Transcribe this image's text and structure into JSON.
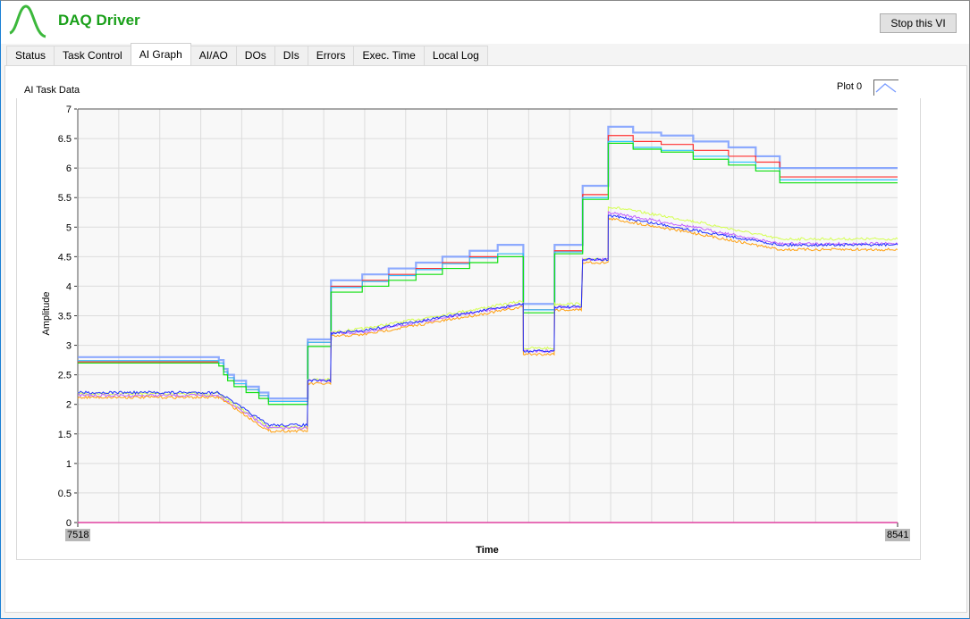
{
  "app": {
    "title": "DAQ Driver",
    "stop_button": "Stop this VI",
    "logo_icon": "sine-wave-logo-icon"
  },
  "tabs": [
    {
      "label": "Status"
    },
    {
      "label": "Task Control"
    },
    {
      "label": "AI Graph",
      "active": true
    },
    {
      "label": "AI/AO"
    },
    {
      "label": "DOs"
    },
    {
      "label": "DIs"
    },
    {
      "label": "Errors"
    },
    {
      "label": "Exec. Time"
    },
    {
      "label": "Local Log"
    }
  ],
  "graph": {
    "title": "AI Task Data",
    "legend_label": "Plot 0",
    "legend_color": "#7a9cff"
  },
  "chart_data": {
    "type": "line",
    "title": "AI Task Data",
    "xlabel": "Time",
    "ylabel": "Amplitude",
    "xlim": [
      7518,
      8541
    ],
    "ylim": [
      0,
      7
    ],
    "x_tick_labels": [
      "7518",
      "8541"
    ],
    "y_ticks": [
      "0",
      "0.5",
      "1",
      "1.5",
      "2",
      "2.5",
      "3",
      "3.5",
      "4",
      "4.5",
      "5",
      "5.5",
      "6",
      "6.5",
      "7"
    ],
    "grid": true,
    "legend": "top-right",
    "step_group": {
      "x": [
        7518,
        7694,
        7700,
        7705,
        7713,
        7728,
        7744,
        7756,
        7805,
        7834,
        7873,
        7906,
        7940,
        7973,
        8007,
        8042,
        8074,
        8113,
        8148,
        8180,
        8211,
        8246,
        8286,
        8330,
        8364,
        8394,
        8541
      ],
      "series": [
        {
          "name": "Plot 0",
          "color": "#7a9cff",
          "values": [
            2.8,
            2.75,
            2.6,
            2.5,
            2.4,
            2.3,
            2.2,
            2.1,
            3.1,
            4.1,
            4.2,
            4.3,
            4.4,
            4.5,
            4.6,
            4.7,
            3.7,
            4.7,
            5.7,
            6.7,
            6.6,
            6.55,
            6.45,
            6.35,
            6.2,
            6.0
          ]
        },
        {
          "color": "#ff3030",
          "values": [
            2.72,
            2.7,
            2.55,
            2.45,
            2.35,
            2.25,
            2.15,
            2.05,
            3.05,
            4.0,
            4.1,
            4.2,
            4.3,
            4.4,
            4.5,
            4.55,
            3.6,
            4.6,
            5.55,
            6.55,
            6.45,
            6.4,
            6.3,
            6.2,
            6.1,
            5.85
          ]
        },
        {
          "color": "#30c0ff",
          "values": [
            2.74,
            2.7,
            2.55,
            2.45,
            2.35,
            2.25,
            2.15,
            2.05,
            3.05,
            3.98,
            4.08,
            4.18,
            4.28,
            4.38,
            4.48,
            4.55,
            3.6,
            4.58,
            5.5,
            6.45,
            6.35,
            6.3,
            6.2,
            6.1,
            6.0,
            5.8
          ]
        },
        {
          "color": "#10e010",
          "values": [
            2.7,
            2.65,
            2.5,
            2.4,
            2.3,
            2.2,
            2.1,
            2.0,
            2.98,
            3.9,
            4.0,
            4.1,
            4.2,
            4.3,
            4.4,
            4.5,
            3.55,
            4.55,
            5.47,
            6.42,
            6.32,
            6.27,
            6.15,
            6.05,
            5.95,
            5.75
          ]
        }
      ]
    },
    "noisy_group": {
      "x": [
        7518,
        7694,
        7756,
        7805,
        7805,
        7834,
        7834,
        7873,
        8074,
        8074,
        8113,
        8113,
        8148,
        8148,
        8180,
        8180,
        8286,
        8394,
        8541
      ],
      "series": [
        {
          "color": "#d4ff50",
          "values": [
            2.18,
            2.18,
            1.62,
            1.62,
            2.42,
            2.42,
            3.22,
            3.28,
            3.75,
            2.95,
            2.95,
            3.7,
            3.7,
            4.45,
            4.45,
            5.35,
            5.1,
            4.8,
            4.8
          ]
        },
        {
          "color": "#c060ff",
          "values": [
            2.15,
            2.15,
            1.6,
            1.6,
            2.4,
            2.4,
            3.2,
            3.22,
            3.7,
            2.9,
            2.9,
            3.65,
            3.65,
            4.45,
            4.45,
            5.25,
            5.0,
            4.72,
            4.72
          ]
        },
        {
          "color": "#ffa010",
          "values": [
            2.12,
            2.12,
            1.55,
            1.55,
            2.35,
            2.35,
            3.15,
            3.18,
            3.65,
            2.85,
            2.85,
            3.6,
            3.6,
            4.4,
            4.4,
            5.15,
            4.9,
            4.62,
            4.62
          ]
        },
        {
          "color": "#2030ff",
          "values": [
            2.2,
            2.2,
            1.65,
            1.65,
            2.4,
            2.4,
            3.2,
            3.25,
            3.7,
            2.9,
            2.9,
            3.65,
            3.65,
            4.45,
            4.45,
            5.2,
            4.95,
            4.7,
            4.7
          ]
        }
      ]
    },
    "baseline_series": {
      "color": "#e040a0",
      "value": 0
    }
  }
}
